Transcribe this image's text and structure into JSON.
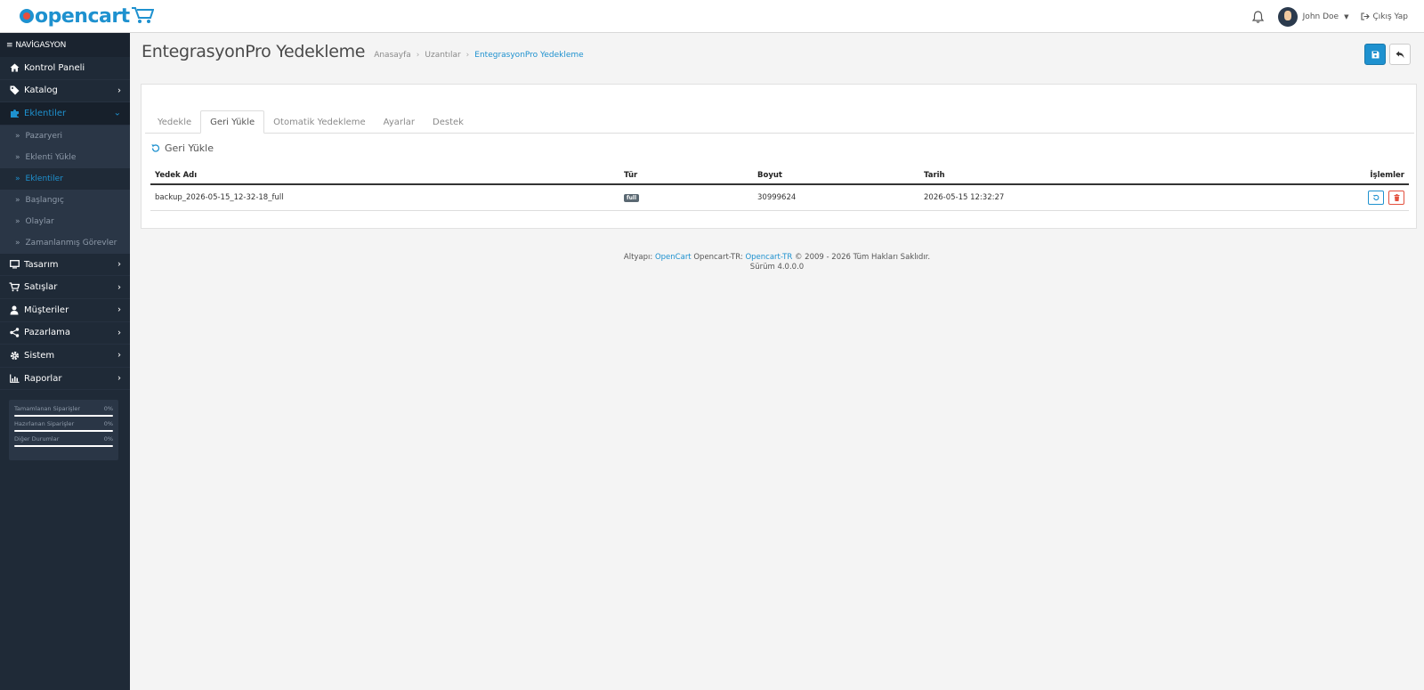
{
  "header": {
    "logo_text": "opencart",
    "user_name": "John Doe",
    "logout_label": "Çıkış Yap"
  },
  "sidebar": {
    "title": "NAVİGASYON",
    "items": [
      {
        "label": "Kontrol Paneli",
        "icon": "home-icon"
      },
      {
        "label": "Katalog",
        "icon": "tag-icon"
      },
      {
        "label": "Eklentiler",
        "icon": "puzzle-icon"
      },
      {
        "label": "Tasarım",
        "icon": "monitor-icon"
      },
      {
        "label": "Satışlar",
        "icon": "cart-icon"
      },
      {
        "label": "Müşteriler",
        "icon": "user-icon"
      },
      {
        "label": "Pazarlama",
        "icon": "share-icon"
      },
      {
        "label": "Sistem",
        "icon": "gear-icon"
      },
      {
        "label": "Raporlar",
        "icon": "chart-icon"
      }
    ],
    "sub_items": [
      {
        "label": "Pazaryeri"
      },
      {
        "label": "Eklenti Yükle"
      },
      {
        "label": "Eklentiler"
      },
      {
        "label": "Başlangıç"
      },
      {
        "label": "Olaylar"
      },
      {
        "label": "Zamanlanmış Görevler"
      }
    ],
    "stats": [
      {
        "label": "Tamamlanan Siparişler",
        "value": "0%"
      },
      {
        "label": "Hazırlanan Siparişler",
        "value": "0%"
      },
      {
        "label": "Diğer Durumlar",
        "value": "0%"
      }
    ]
  },
  "page": {
    "title": "EntegrasyonPro Yedekleme",
    "breadcrumb": [
      "Anasayfa",
      "Uzantılar",
      "EntegrasyonPro Yedekleme"
    ]
  },
  "tabs": [
    "Yedekle",
    "Geri Yükle",
    "Otomatik Yedekleme",
    "Ayarlar",
    "Destek"
  ],
  "section_title": "Geri Yükle",
  "table": {
    "headers": [
      "Yedek Adı",
      "Tür",
      "Boyut",
      "Tarih",
      "İşlemler"
    ],
    "rows": [
      {
        "name": "backup_2026-05-15_12-32-18_full",
        "type": "full",
        "size": "30999624",
        "date": "2026-05-15 12:32:27"
      }
    ]
  },
  "footer": {
    "prefix": "Altyapı:",
    "link1": "OpenCart",
    "middle": "Opencart-TR:",
    "link2": "Opencart-TR",
    "suffix": "© 2009 - 2026 Tüm Hakları Saklıdır.",
    "version": "Sürüm 4.0.0.0"
  },
  "colors": {
    "primary": "#1e91cf",
    "sidebar_bg": "#1f2a37",
    "danger": "#e3503e"
  }
}
